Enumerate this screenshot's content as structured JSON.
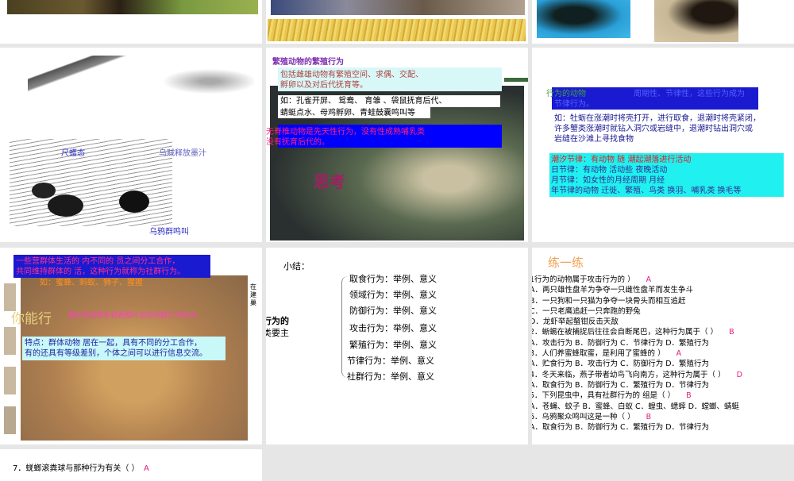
{
  "slide2": {
    "title": "繁殖动物的繁殖行为",
    "desc": [
      "包括雌雄动物有繁殖空间、求偶、交配、",
      "孵卵以及对后代抚育等。"
    ],
    "examples": [
      "如：孔雀开屏、 鸳鸯、 育雏 、袋鼠抚育后代、",
      "蜻蜓点水、母鸡孵卵、青蛙鼓囊鸣叫等"
    ],
    "note": [
      "无脊椎动物是先天性行为，没有性成熟哺乳类",
      "没有抚育后代的。"
    ],
    "think": "思考"
  },
  "slide1": {
    "label_left": "尺蠖态",
    "label_right": "乌贼释放墨汁",
    "label_bottom": "乌鸦群鸣叫"
  },
  "slide3": {
    "head": [
      "行为的动物",
      "周期性、节律性，这些行为成为",
      "节律行为。"
    ],
    "example": [
      "如：牡蛎在涨潮时将壳打开，进行取食，退潮时将壳紧闭，",
      "许多蟹类涨潮时就钻入洞穴或岩缝中，退潮时钻出洞穴或",
      "岩缝在沙滩上寻找食物"
    ],
    "rhythms": [
      "潮汐节律：有动物 随 潮起潮落进行活动",
      "日节律：有动物 活动些 夜晚活动",
      "月节律：如女性的月经周期 月经",
      "年节律的动物 迁徙、繁殖、鸟类 换羽、哺乳类 换毛等"
    ]
  },
  "slide4": {
    "definition": [
      "一些营群体生活的 内不同的 员之间分工合作，",
      "共同维持群体的 活，这种行为就称为社群行为。"
    ],
    "examples": "如：蜜蜂、蚂蚁、狮子、猩猩",
    "side": [
      "在",
      "建",
      "巢"
    ],
    "you_can": "你能行",
    "prompt": "通过阅读课本和看图片总结社群行为特点。",
    "feature": [
      "特点：群体动物 居在一起，具有不同的分工合作，",
      "有的还具有等级差别，个体之间可以进行信息交流。"
    ]
  },
  "slide5": {
    "title": "小结：",
    "left": [
      "行为的",
      "类要主"
    ],
    "items": [
      "取食行为：举例、意义",
      "领域行为：举例、意义",
      "防御行为：举例、意义",
      "攻击行为：举例、意义",
      "繁殖行为：举例、意义",
      "节律行为：举例、意义",
      "社群行为：举例、意义"
    ]
  },
  "slide6": {
    "title": "练一练",
    "lines": [
      {
        "text": "1行为的动物属于攻击行为的 ）",
        "ans": "A"
      },
      {
        "text": "A．两只雄性盘羊为争夺一只雌性盘羊而发生争斗",
        "ans": ""
      },
      {
        "text": "B．一只狗和一只猫为争夺一块骨头而相互追赶",
        "ans": ""
      },
      {
        "text": "C．一只老鹰追赶一只奔跑的野兔",
        "ans": ""
      },
      {
        "text": "D．龙虾举起螯钳反击天敌",
        "ans": ""
      },
      {
        "text": "2．蜥蜴在被捕捉后往往会自断尾巴，这种行为属于（ ）",
        "ans": "B"
      },
      {
        "text": "A．攻击行为 B．防御行为 C．节律行为 D．繁殖行为",
        "ans": ""
      },
      {
        "text": "3．人们养蜜蜂取蜜，是利用了蜜蜂的 ）",
        "ans": "A"
      },
      {
        "text": "A．贮食行为 B．攻击行为 C．防御行为 D．繁殖行为",
        "ans": ""
      },
      {
        "text": "4．冬天来临，燕子带者幼鸟飞向南方，这种行为属于（ ）",
        "ans": "D"
      },
      {
        "text": "A．取食行为 B．防御行为 C．繁殖行为 D．节律行为",
        "ans": ""
      },
      {
        "text": "5．下列昆虫中，具有社群行为的 组是（ ）",
        "ans": "B"
      },
      {
        "text": "A．苍蝇、蚊子 B．蜜蜂、白蚁 C．蝗虫、蟋蟀 D．螳螂、蜻蜓",
        "ans": ""
      },
      {
        "text": "6．乌鸦聚众鸣叫这是一种（ ）",
        "ans": "B"
      },
      {
        "text": "A．取食行为 B．防御行为 C．繁殖行为 D．节律行为",
        "ans": ""
      }
    ]
  },
  "slide7": {
    "q": "7．蜣螂滚粪球与那种行为有关（ ）",
    "ans": "A"
  }
}
